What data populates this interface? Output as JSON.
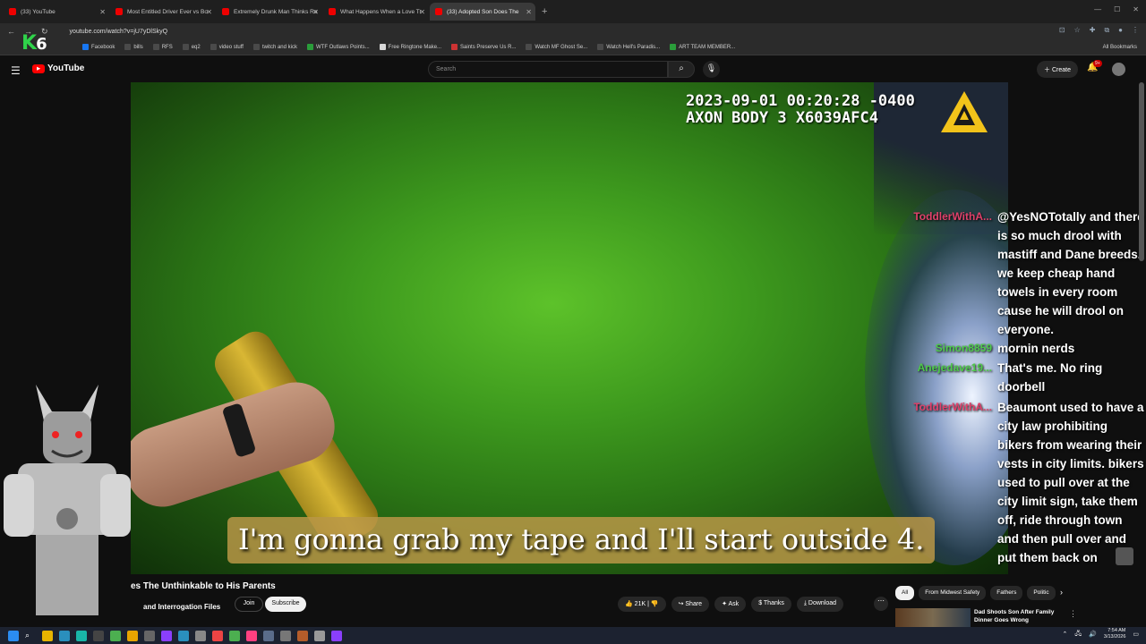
{
  "browser": {
    "tabs": [
      {
        "label": "(33) YouTube",
        "active": false
      },
      {
        "label": "Most Entitled Driver Ever vs Bo",
        "active": false
      },
      {
        "label": "Extremely Drunk Man Thinks Re",
        "active": false
      },
      {
        "label": "What Happens When a Love Tr",
        "active": false
      },
      {
        "label": "(33) Adopted Son Does The",
        "active": true
      }
    ],
    "new_tab": "+",
    "url": "youtube.com/watch?v=jU7yDlSkyQ",
    "bookmarks": [
      "Facebook",
      "bills",
      "RFS",
      "eq2",
      "video stuff",
      "twitch and kick",
      "WTF Outlaws Points...",
      "Free Ringtone Make...",
      "Saints Preserve Us R...",
      "Watch MF Ghost Se...",
      "Watch Hell's Paradis...",
      "ART TEAM MEMBER..."
    ],
    "all_bookmarks": "All Bookmarks"
  },
  "overlay_logo": {
    "letter": "K",
    "digit": "6"
  },
  "youtube": {
    "brand": "YouTube",
    "search_placeholder": "Search",
    "create_label": "Create",
    "notif_count": "9+"
  },
  "video": {
    "timestamp": "2023-09-01 00:20:28 -0400",
    "device": "AXON BODY 3 X6039AFC4",
    "caption": "I'm gonna grab my tape and I'll start outside 4."
  },
  "chat": [
    {
      "user": "ToddlerWithA...",
      "color": "#e0406a",
      "text": "@YesNOTotally and there is so much drool with mastiff and Dane breeds. we keep cheap hand towels in every room cause he will drool on everyone."
    },
    {
      "user": "Simon8859",
      "color": "#4ec94a",
      "text": "mornin nerds"
    },
    {
      "user": "Anejedave19...",
      "color": "#4ec94a",
      "text": "That's me. No ring doorbell"
    },
    {
      "user": "ToddlerWithA...",
      "color": "#e0406a",
      "text": "Beaumont used to have a city law prohibiting bikers from wearing their vests in city limits. bikers used to pull over at the city limit sign, take them off, ride through town and then pull over and put them back on"
    }
  ],
  "below_video": {
    "title": "es The Unthinkable to His Parents",
    "channel": "and Interrogation Files",
    "join": "Join",
    "subscribe": "Subscribe",
    "actions": {
      "likes": "21K",
      "share": "Share",
      "ask": "Ask",
      "thanks": "Thanks",
      "download": "Download"
    }
  },
  "sidebar": {
    "chips": [
      "All",
      "From Midwest Safety",
      "Fathers",
      "Politic"
    ],
    "rec_title": "Dad Shoots Son After Family Dinner Goes Wrong"
  },
  "taskbar": {
    "time": "7:54 AM",
    "date": "3/13/2026"
  }
}
